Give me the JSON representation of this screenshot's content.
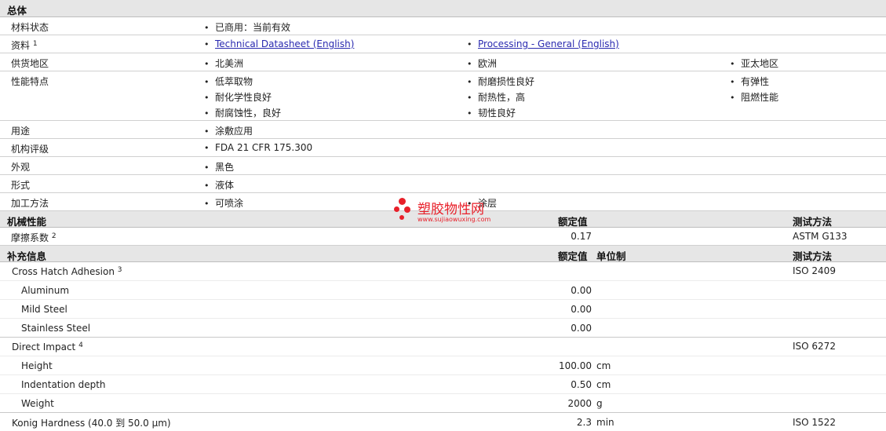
{
  "general": {
    "header": "总体",
    "rows": [
      {
        "label": "材料状态",
        "values": [
          "已商用：当前有效"
        ]
      },
      {
        "label": "资料",
        "sup": "1",
        "links": [
          "Technical Datasheet (English)",
          "Processing - General (English)"
        ]
      },
      {
        "label": "供货地区",
        "values": [
          "北美洲",
          "欧洲",
          "亚太地区"
        ]
      },
      {
        "label": "性能特点",
        "values": [
          "低萃取物",
          "耐磨损性良好",
          "有弹性",
          "耐化学性良好",
          "耐热性，高",
          "阻燃性能",
          "耐腐蚀性，良好",
          "韧性良好"
        ]
      },
      {
        "label": "用途",
        "values": [
          "涂敷应用"
        ]
      },
      {
        "label": "机构评级",
        "values": [
          "FDA 21 CFR 175.300"
        ]
      },
      {
        "label": "外观",
        "values": [
          "黑色"
        ]
      },
      {
        "label": "形式",
        "values": [
          "液体"
        ]
      },
      {
        "label": "加工方法",
        "values": [
          "可喷涂",
          "涂层"
        ]
      }
    ]
  },
  "mechanical": {
    "header": "机械性能",
    "col_value": "额定值",
    "col_test": "测试方法",
    "rows": [
      {
        "label": "摩擦系数",
        "sup": "2",
        "value": "0.17",
        "test": "ASTM G133"
      }
    ]
  },
  "supplementary": {
    "header": "补充信息",
    "col_value": "额定值",
    "col_unit": "单位制",
    "col_test": "测试方法",
    "groups": [
      {
        "label": "Cross Hatch Adhesion",
        "sup": "3",
        "test": "ISO 2409",
        "items": [
          {
            "label": "Aluminum",
            "value": "0.00",
            "unit": ""
          },
          {
            "label": "Mild Steel",
            "value": "0.00",
            "unit": ""
          },
          {
            "label": "Stainless Steel",
            "value": "0.00",
            "unit": ""
          }
        ]
      },
      {
        "label": "Direct Impact",
        "sup": "4",
        "test": "ISO 6272",
        "items": [
          {
            "label": "Height",
            "value": "100.00",
            "unit": "cm"
          },
          {
            "label": "Indentation depth",
            "value": "0.50",
            "unit": "cm"
          },
          {
            "label": "Weight",
            "value": "2000",
            "unit": "g"
          }
        ]
      }
    ],
    "last": {
      "label": "Konig Hardness (40.0 到  50.0 µm)",
      "value": "2.3",
      "unit": "min",
      "test": "ISO 1522"
    }
  },
  "watermark": {
    "title": "塑胶物性网",
    "url": "www.sujiaowuxing.com",
    "color": "#e8202a"
  }
}
